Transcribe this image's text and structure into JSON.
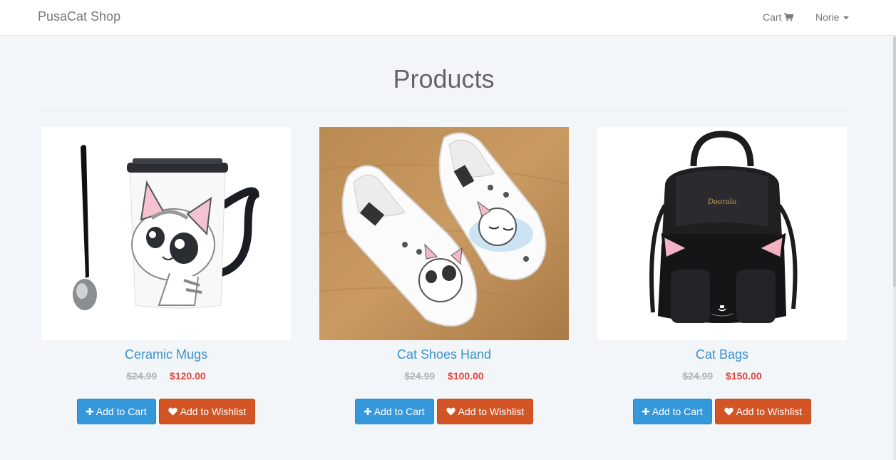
{
  "navbar": {
    "brand": "PusaCat Shop",
    "cart_label": "Cart",
    "user_label": "Norie"
  },
  "page": {
    "title": "Products"
  },
  "products": [
    {
      "name": "Ceramic Mugs",
      "old_price": "$24.99",
      "price": "$120.00",
      "add_to_cart_label": "Add to Cart",
      "add_to_wishlist_label": "Add to Wishlist"
    },
    {
      "name": "Cat Shoes Hand",
      "old_price": "$24.99",
      "price": "$100.00",
      "add_to_cart_label": "Add to Cart",
      "add_to_wishlist_label": "Add to Wishlist"
    },
    {
      "name": "Cat Bags",
      "old_price": "$24.99",
      "price": "$150.00",
      "add_to_cart_label": "Add to Cart",
      "add_to_wishlist_label": "Add to Wishlist"
    }
  ],
  "colors": {
    "brand_blue": "#3498db",
    "wishlist_orange": "#d35425",
    "price_red": "#e0453f",
    "link_blue": "#3a8fc8"
  },
  "icons": {
    "cart": "shopping-cart-icon",
    "plus": "plus-icon",
    "heart": "heart-icon",
    "caret": "caret-down-icon"
  }
}
